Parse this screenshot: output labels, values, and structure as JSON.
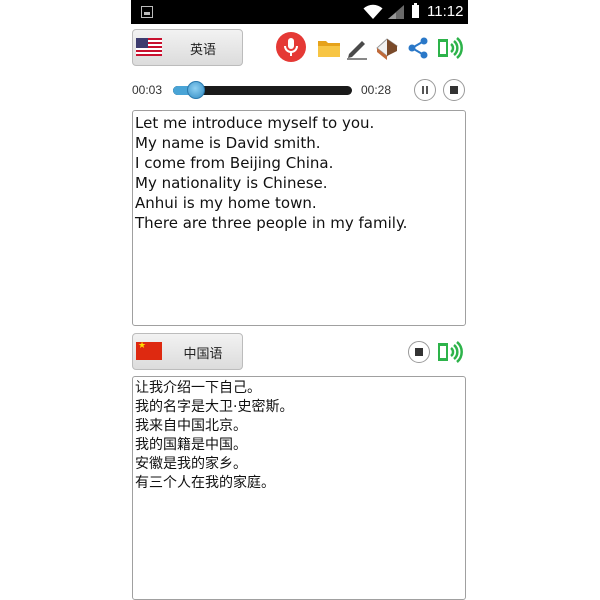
{
  "status_bar": {
    "time": "11:12",
    "icons": [
      "gallery-icon",
      "wifi-icon",
      "signal-icon",
      "battery-icon"
    ]
  },
  "source": {
    "language_label": "英语",
    "flag": "us-flag-icon",
    "text_lines": [
      "Let me introduce myself to you.",
      "My name is David smith.",
      "I come from Beijing China.",
      "My nationality is Chinese.",
      "Anhui is my home town.",
      "There are three people in my family."
    ]
  },
  "toolbar": {
    "icons": [
      "microphone-icon",
      "folder-icon",
      "pencil-icon",
      "eraser-icon",
      "share-icon",
      "speaker-icon"
    ],
    "mic_color": "#e53935",
    "accent_green": "#2db34a"
  },
  "player": {
    "current_time": "00:03",
    "total_time": "00:28",
    "progress": 0.13,
    "track_color": "#1a1a1a",
    "fill_color": "#49a4d6"
  },
  "target": {
    "language_label": "中国语",
    "flag": "cn-flag-icon",
    "text_lines": [
      "让我介绍一下自己。",
      "我的名字是大卫·史密斯。",
      "我来自中国北京。",
      "我的国籍是中国。",
      "安徽是我的家乡。",
      "有三个人在我的家庭。"
    ]
  }
}
